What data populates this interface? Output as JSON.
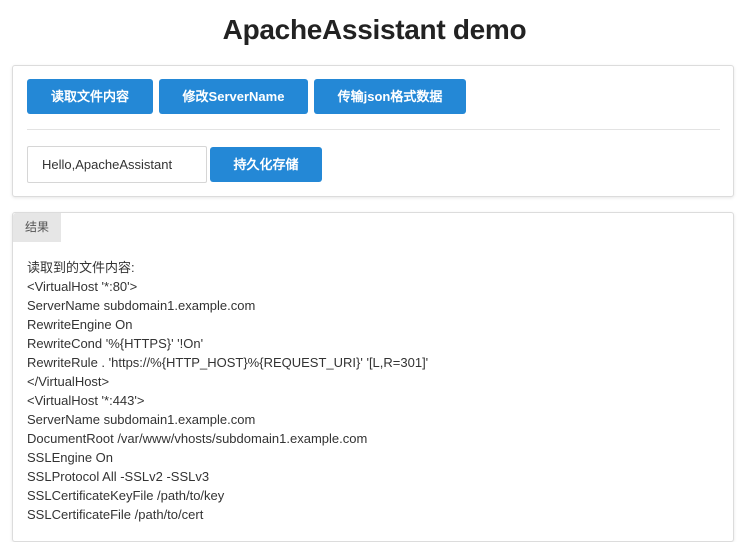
{
  "header": {
    "title": "ApacheAssistant demo"
  },
  "controls": {
    "read_button": "读取文件内容",
    "edit_button": "修改ServerName",
    "json_button": "传输json格式数据",
    "input_value": "Hello,ApacheAssistant",
    "save_button": "持久化存储"
  },
  "result": {
    "tab_label": "结果",
    "lines": [
      "读取到的文件内容:",
      "<VirtualHost '*:80'>",
      "ServerName subdomain1.example.com",
      "RewriteEngine On",
      "RewriteCond '%{HTTPS}' '!On'",
      "RewriteRule . 'https://%{HTTP_HOST}%{REQUEST_URI}' '[L,R=301]'",
      "</VirtualHost>",
      "<VirtualHost '*:443'>",
      "ServerName subdomain1.example.com",
      "DocumentRoot /var/www/vhosts/subdomain1.example.com",
      "SSLEngine On",
      "SSLProtocol All -SSLv2 -SSLv3",
      "SSLCertificateKeyFile /path/to/key",
      "SSLCertificateFile /path/to/cert"
    ]
  },
  "colors": {
    "button_primary": "#2488d6",
    "tab_background": "#e6e6e6"
  }
}
